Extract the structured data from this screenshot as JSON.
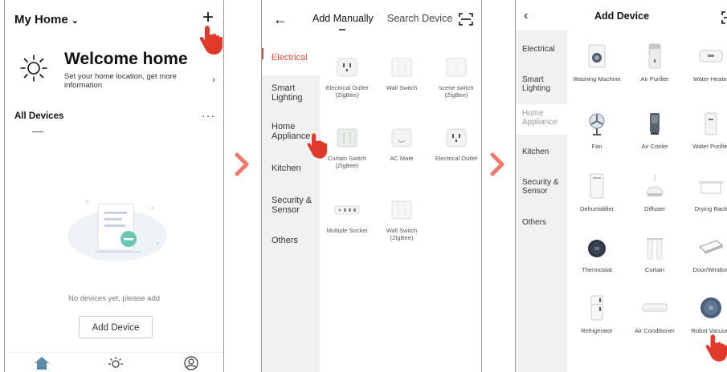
{
  "screen1": {
    "home_title": "My Home",
    "welcome_title": "Welcome home",
    "welcome_subtitle": "Set your home location, get more information",
    "section_title": "All Devices",
    "empty_text": "No devices yet, please add",
    "add_button": "Add Device",
    "icons": {
      "add": "plus-icon",
      "menu": "more-dots-icon",
      "home_tab": "home-icon",
      "scene_tab": "sun-icon",
      "profile_tab": "user-icon"
    }
  },
  "screen2": {
    "tab_active": "Add Manually",
    "tab_search": "Search Device",
    "categories": [
      "Electrical",
      "Smart Lighting",
      "Home Appliance",
      "Kitchen",
      "Security & Sensor",
      "Others"
    ],
    "selected_category": "Electrical",
    "devices": [
      "Electrical Outlet (ZigBee)",
      "Wall Switch",
      "scene switch (ZigBee)",
      "Curtain Switch (ZigBee)",
      "AC Mate",
      "Electrical Outlet",
      "Multiple Socket",
      "Wall Switch (ZigBee)"
    ]
  },
  "screen3": {
    "title": "Add Device",
    "categories": [
      "Electrical",
      "Smart Lighting",
      "Home Appliance",
      "Kitchen",
      "Security & Sensor",
      "Others"
    ],
    "selected_category": "Home Appliance",
    "devices": [
      "Washing Machine",
      "Air Purifier",
      "Water Heater",
      "Fan",
      "Air Cooler",
      "Water Purifier",
      "Dehumidifier",
      "Diffuser",
      "Drying Rack",
      "Thermostat",
      "Curtain",
      "Door/Window",
      "Refrigerator",
      "Air Conditioner",
      "Robot Vacuum"
    ]
  },
  "colors": {
    "accent_red": "#e23a2a",
    "arrow_pink": "#f27a6a",
    "sidebar_bg": "#f1f1f1",
    "selected_bar": "#e14b3b"
  }
}
